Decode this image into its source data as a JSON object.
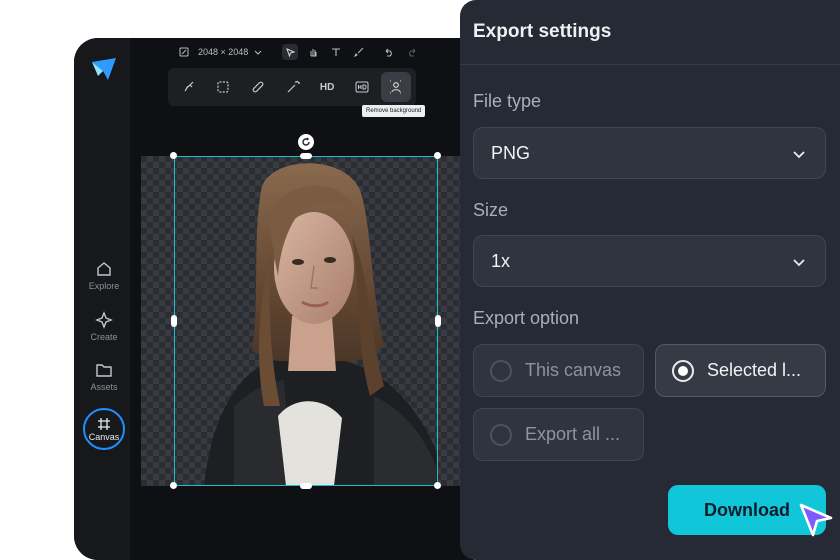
{
  "editor": {
    "canvas_size": "2048 × 2048",
    "tooltip": "Remove background",
    "tools": [
      "eraser-brush",
      "crop",
      "healing",
      "magic-wand",
      "HD",
      "HD+",
      "remove-background"
    ],
    "hd_label": "HD",
    "sidebar": [
      {
        "label": "Explore",
        "icon": "home-icon"
      },
      {
        "label": "Create",
        "icon": "sparkle-icon"
      },
      {
        "label": "Assets",
        "icon": "folder-icon"
      },
      {
        "label": "Canvas",
        "icon": "hash-icon",
        "active": true
      }
    ]
  },
  "export": {
    "title": "Export settings",
    "file_type_label": "File type",
    "file_type_value": "PNG",
    "size_label": "Size",
    "size_value": "1x",
    "export_option_label": "Export option",
    "options": [
      {
        "label": "This canvas",
        "checked": false
      },
      {
        "label": "Selected l...",
        "checked": true
      },
      {
        "label": "Export all ...",
        "checked": false
      }
    ],
    "download_label": "Download"
  },
  "colors": {
    "accent": "#11c6d9",
    "selection": "#19c2c8",
    "panel_bg": "#262a34",
    "cursor": "#7b5cff"
  }
}
